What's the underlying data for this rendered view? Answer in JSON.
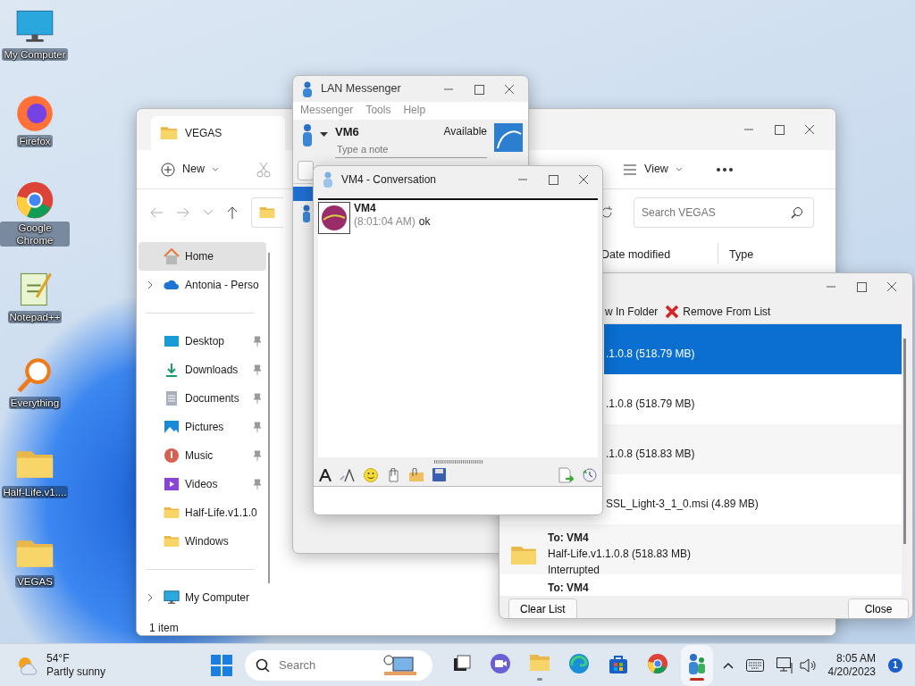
{
  "desktop_icons": [
    {
      "label": "My Computer",
      "kind": "monitor"
    },
    {
      "label": "Firefox",
      "kind": "firefox"
    },
    {
      "label": "Google Chrome",
      "kind": "chrome"
    },
    {
      "label": "Notepad++",
      "kind": "notepad"
    },
    {
      "label": "Everything",
      "kind": "magnifier"
    },
    {
      "label": "Half-Life.v1....",
      "kind": "folder"
    },
    {
      "label": "VEGAS",
      "kind": "folder"
    }
  ],
  "explorer": {
    "title": "VEGAS",
    "toolbar": [
      "New",
      "View"
    ],
    "search": {
      "placeholder": "Search VEGAS"
    },
    "columns": [
      "Date modified",
      "Type"
    ],
    "nav": [
      [
        {
          "label": "Home",
          "kind": "home",
          "selected": true,
          "pinned": false,
          "expandable": false
        },
        {
          "label": "Antonia - Perso",
          "kind": "cloud",
          "selected": false,
          "pinned": false,
          "expandable": true
        }
      ],
      [
        {
          "label": "Desktop",
          "kind": "desktop",
          "selected": false,
          "pinned": true,
          "expandable": false
        },
        {
          "label": "Downloads",
          "kind": "download",
          "selected": false,
          "pinned": true,
          "expandable": false
        },
        {
          "label": "Documents",
          "kind": "document",
          "selected": false,
          "pinned": true,
          "expandable": false
        },
        {
          "label": "Pictures",
          "kind": "picture",
          "selected": false,
          "pinned": true,
          "expandable": false
        },
        {
          "label": "Music",
          "kind": "music",
          "selected": false,
          "pinned": true,
          "expandable": false
        },
        {
          "label": "Videos",
          "kind": "video",
          "selected": false,
          "pinned": true,
          "expandable": false
        },
        {
          "label": "Half-Life.v1.1.0",
          "kind": "folder",
          "selected": false,
          "pinned": false,
          "expandable": false
        },
        {
          "label": "Windows",
          "kind": "folder",
          "selected": false,
          "pinned": false,
          "expandable": false
        }
      ],
      [
        {
          "label": "My Computer",
          "kind": "monitor",
          "selected": false,
          "pinned": false,
          "expandable": true
        }
      ]
    ],
    "status": "1 item"
  },
  "messenger": {
    "title": "LAN Messenger",
    "menu": [
      "Messenger",
      "Tools",
      "Help"
    ],
    "user": {
      "name": "VM6",
      "status": "Available",
      "note": {
        "placeholder": "Type a note"
      }
    }
  },
  "transfers": {
    "toolbar": [
      "w In Folder",
      "Remove From List"
    ],
    "rows": [
      {
        "file": ".1.0.8 (518.79 MB)",
        "selected": true,
        "covered": true
      },
      {
        "file": ".1.0.8 (518.79 MB)",
        "selected": false,
        "covered": true
      },
      {
        "file": ".1.0.8 (518.83 MB)",
        "selected": false,
        "covered": true
      },
      {
        "file": "SSL_Light-3_1_0.msi (4.89 MB)",
        "selected": false,
        "covered": true
      },
      {
        "to": "To: VM4",
        "file": "Half-Life.v1.1.0.8 (518.83 MB)",
        "status": "Interrupted",
        "selected": false,
        "covered": false
      },
      {
        "to": "To: VM4",
        "selected": false,
        "covered": false
      }
    ],
    "buttons": [
      "Clear List",
      "Close"
    ]
  },
  "conversation": {
    "title": "VM4 - Conversation",
    "messages": [
      {
        "sender": "VM4",
        "time": "(8:01:04 AM)",
        "text": "ok"
      }
    ]
  },
  "taskbar": {
    "weather": {
      "temp": "54°F",
      "desc": "Partly sunny"
    },
    "search": {
      "placeholder": "Search"
    },
    "apps": [
      {
        "kind": "taskview",
        "open": false,
        "selected": false
      },
      {
        "kind": "meet",
        "open": false,
        "selected": false
      },
      {
        "kind": "explorer",
        "open": true,
        "selected": false
      },
      {
        "kind": "edge",
        "open": false,
        "selected": false
      },
      {
        "kind": "store",
        "open": false,
        "selected": false
      },
      {
        "kind": "chrome",
        "open": false,
        "selected": false
      },
      {
        "kind": "messenger",
        "open": true,
        "selected": true
      }
    ],
    "time": "8:05 AM",
    "date": "4/20/2023",
    "notifications": "1"
  }
}
